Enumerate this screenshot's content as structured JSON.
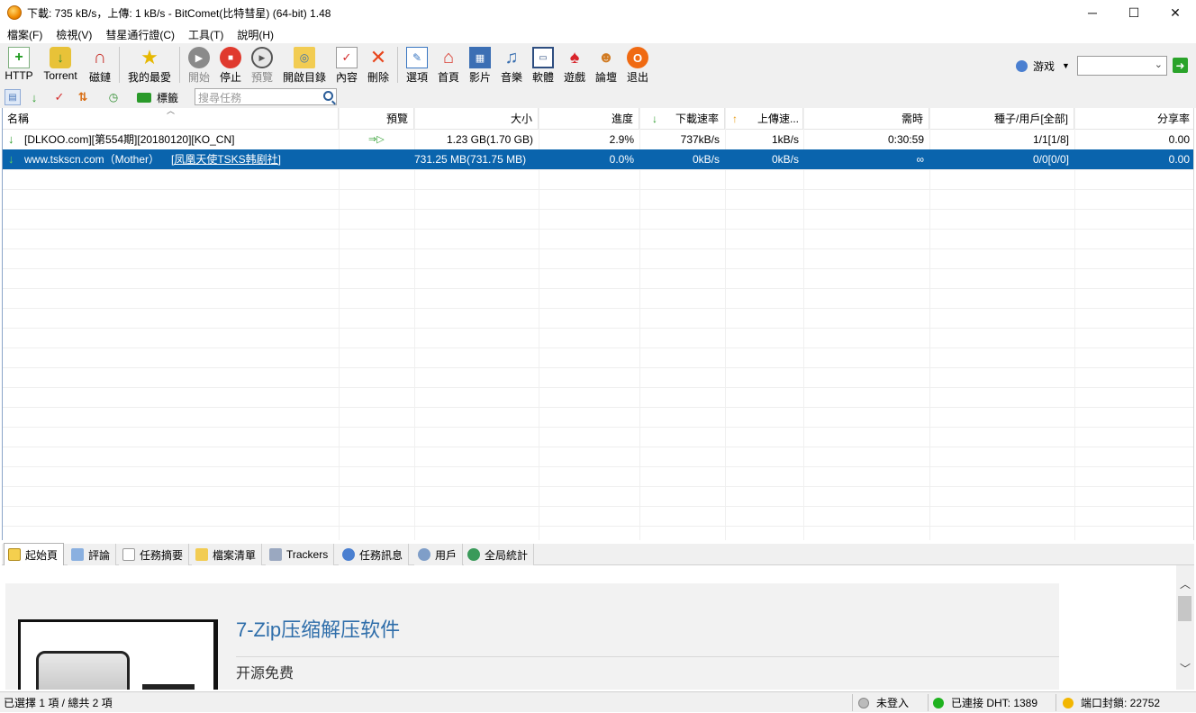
{
  "window": {
    "title": "下載: 735 kB/s，上傳: 1 kB/s - BitComet(比特彗星) (64-bit) 1.48",
    "minimize_glyph": "─",
    "maximize_glyph": "☐",
    "close_glyph": "✕"
  },
  "menu": [
    "檔案(F)",
    "檢視(V)",
    "彗星通行證(C)",
    "工具(T)",
    "說明(H)"
  ],
  "toolbar": {
    "http": "HTTP",
    "torrent": "Torrent",
    "magnet": "磁鏈",
    "favorites": "我的最愛",
    "start": "開始",
    "stop": "停止",
    "preview": "預覽",
    "open_dir": "開啟目錄",
    "content": "內容",
    "delete": "刪除",
    "options": "選項",
    "home": "首頁",
    "video": "影片",
    "music": "音樂",
    "software": "軟體",
    "games": "遊戲",
    "forum": "論壇",
    "exit": "退出",
    "game_dropdown": "游戏",
    "combo_value": ""
  },
  "toolbar2": {
    "tags_label": "標籤",
    "search_placeholder": "搜尋任務"
  },
  "columns": {
    "name": "名稱",
    "preview": "預覽",
    "size": "大小",
    "progress": "進度",
    "down_speed": "下載速率",
    "up_speed": "上傳速...",
    "eta": "需時",
    "seeds": "種子/用戶[全部]",
    "ratio": "分享率"
  },
  "tasks": [
    {
      "name": "[DLKOO.com][第554期][20180120][KO_CN]",
      "preview": "⇒▷",
      "size": "1.23 GB(1.70 GB)",
      "progress": "2.9%",
      "down": "737kB/s",
      "up": "1kB/s",
      "eta": "0:30:59",
      "seeds": "1/1[1/8]",
      "ratio": "0.00"
    },
    {
      "name": "www.tskscn.com（Mother）",
      "name_link": "[凤凰天使TSKS韩剧社]",
      "preview": "",
      "size": "731.25 MB(731.75 MB)",
      "progress": "0.0%",
      "down": "0kB/s",
      "up": "0kB/s",
      "eta": "∞",
      "seeds": "0/0[0/0]",
      "ratio": "0.00"
    }
  ],
  "tabs": [
    "起始頁",
    "評論",
    "任務摘要",
    "檔案清單",
    "Trackers",
    "任務訊息",
    "用戶",
    "全局統計"
  ],
  "ad": {
    "title": "7-Zip压缩解压软件",
    "subtitle": "开源免费"
  },
  "status": {
    "selection": "已選擇 1 項 / 總共 2 項",
    "login": "未登入",
    "dht": "已連接 DHT: 1389",
    "port": "端口封鎖: 22752"
  },
  "colors": {
    "selection": "#0a64ad",
    "link": "#ffffff",
    "ad_title": "#2f6eaa",
    "dht_dot": "#1fb21f",
    "port_dot": "#f2b600"
  }
}
